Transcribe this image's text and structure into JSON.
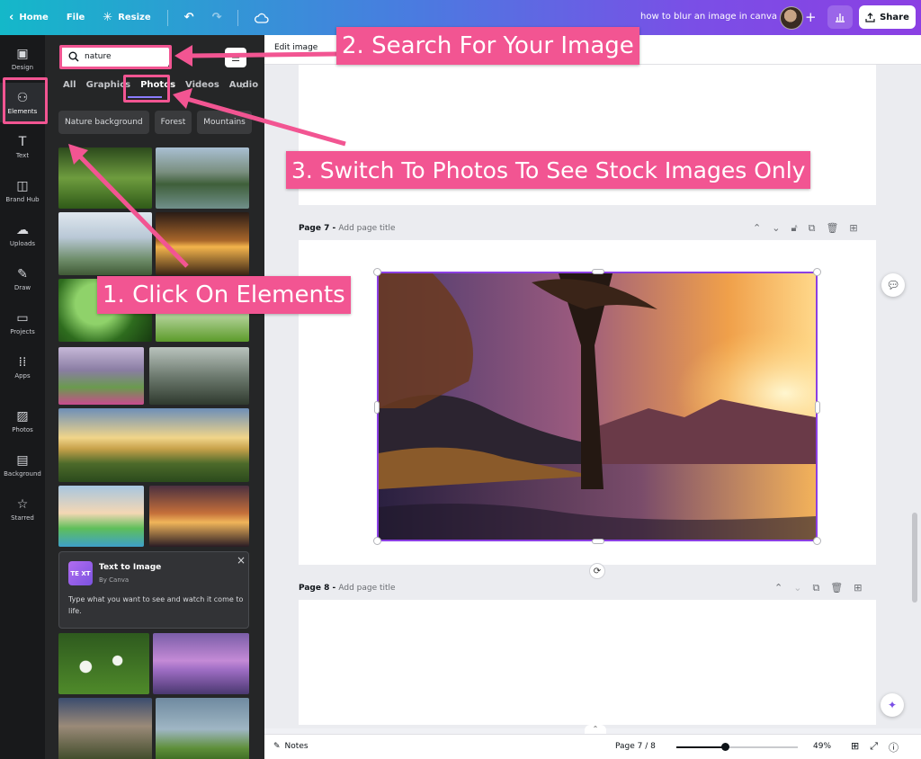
{
  "topbar": {
    "home_label": "Home",
    "file_label": "File",
    "resize_label": "Resize",
    "doc_title": "how to blur an image in canva",
    "share_label": "Share"
  },
  "rail": {
    "items": [
      {
        "label": "Design",
        "icon": "layout-icon"
      },
      {
        "label": "Elements",
        "icon": "shapes-icon"
      },
      {
        "label": "Text",
        "icon": "text-icon"
      },
      {
        "label": "Brand Hub",
        "icon": "brand-icon"
      },
      {
        "label": "Uploads",
        "icon": "cloud-upload-icon"
      },
      {
        "label": "Draw",
        "icon": "pen-icon"
      },
      {
        "label": "Projects",
        "icon": "folder-icon"
      },
      {
        "label": "Apps",
        "icon": "grid-icon"
      },
      {
        "label": "Photos",
        "icon": "image-icon"
      },
      {
        "label": "Background",
        "icon": "pattern-icon"
      },
      {
        "label": "Starred",
        "icon": "star-icon"
      }
    ]
  },
  "panel": {
    "search_value": "nature",
    "tabs": [
      "All",
      "Graphics",
      "Photos",
      "Videos",
      "Audio"
    ],
    "active_tab": "Photos",
    "chips": [
      "Nature background",
      "Forest",
      "Mountains"
    ],
    "text_to_image": {
      "title": "Text to Image",
      "by": "By Canva",
      "description": "Type what you want to see and watch it come to life."
    }
  },
  "canvas": {
    "context_label": "Edit image",
    "page7": {
      "label": "Page 7 - ",
      "placeholder": "Add page title"
    },
    "page8": {
      "label": "Page 8 - ",
      "placeholder": "Add page title"
    }
  },
  "bottombar": {
    "notes_label": "Notes",
    "page_indicator": "Page 7 / 8",
    "zoom_label": "49%",
    "zoom_fraction": 0.4
  },
  "annotations": {
    "step1": "1. Click On Elements",
    "step2": "2. Search For Your Image",
    "step3": "3. Switch To Photos To See Stock Images Only"
  },
  "colors": {
    "accent_pink": "#f25592",
    "selection_purple": "#8b3fe3",
    "panel_dark": "#252627",
    "rail_dark": "#18191b"
  }
}
